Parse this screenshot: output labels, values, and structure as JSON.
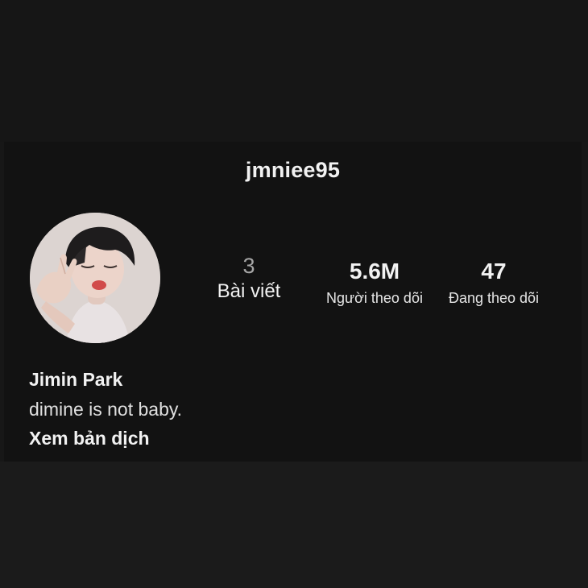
{
  "profile": {
    "username": "jmniee95",
    "display_name": "Jimin Park",
    "bio": "dimine is not baby.",
    "translate_link": "Xem bản dịch"
  },
  "stats": {
    "posts": {
      "count": "3",
      "label": "Bài viết"
    },
    "followers": {
      "count": "5.6M",
      "label": "Người theo dõi"
    },
    "following": {
      "count": "47",
      "label": "Đang theo dõi"
    }
  },
  "colors": {
    "background": "#171717",
    "card": "#121212",
    "text": "#f2f2f2",
    "muted": "#a6a6a6"
  },
  "icons": {
    "avatar": "profile-photo"
  }
}
